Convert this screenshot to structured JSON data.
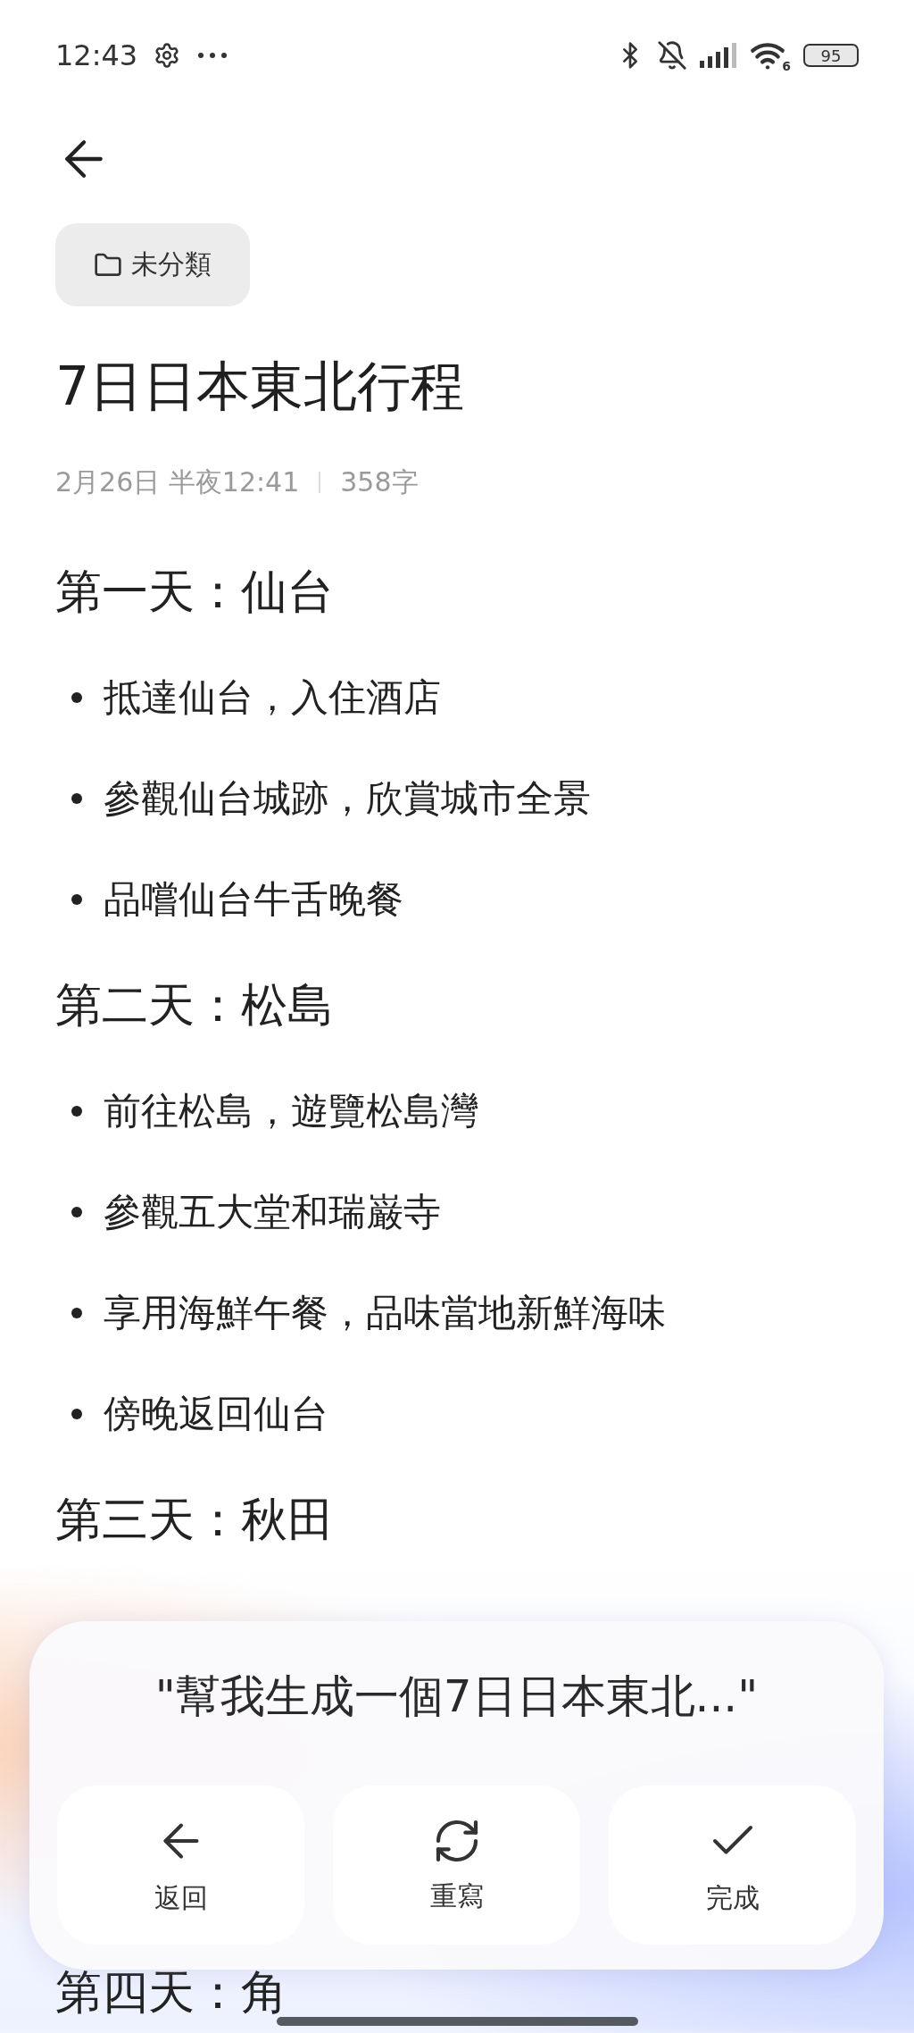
{
  "status_bar": {
    "time": "12:43",
    "wifi_badge": "6",
    "battery": "95"
  },
  "note": {
    "category": "未分類",
    "title": "7日日本東北行程",
    "date": "2月26日 半夜12:41",
    "word_count": "358字"
  },
  "sections": [
    {
      "heading": "第一天：仙台",
      "items": [
        "抵達仙台，入住酒店",
        "參觀仙台城跡，欣賞城市全景",
        "品嚐仙台牛舌晚餐"
      ]
    },
    {
      "heading": "第二天：松島",
      "items": [
        "前往松島，遊覽松島灣",
        "參觀五大堂和瑞巌寺",
        "享用海鮮午餐，品味當地新鮮海味",
        "傍晚返回仙台"
      ]
    },
    {
      "heading": "第三天：秋田"
    },
    {
      "heading": "第四天：角"
    }
  ],
  "ai_panel": {
    "prompt": "\"幫我生成一個7日日本東北...\"",
    "buttons": [
      {
        "kind": "back",
        "label": "返回"
      },
      {
        "kind": "rewrite",
        "label": "重寫"
      },
      {
        "kind": "done",
        "label": "完成"
      }
    ]
  }
}
